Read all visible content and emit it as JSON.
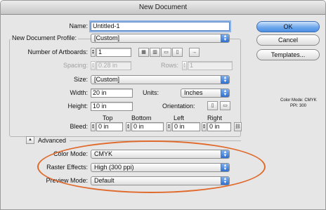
{
  "window": {
    "title": "New Document"
  },
  "name": {
    "label": "Name:",
    "value": "Untitled-1"
  },
  "profile": {
    "label": "New Document Profile:",
    "value": "[Custom]"
  },
  "artboards": {
    "label": "Number of Artboards:",
    "value": "1"
  },
  "spacing": {
    "label": "Spacing:",
    "value": "0.28 in"
  },
  "rows": {
    "label": "Rows:",
    "value": "1"
  },
  "size": {
    "label": "Size:",
    "value": "[Custom]"
  },
  "width": {
    "label": "Width:",
    "value": "20 in"
  },
  "units": {
    "label": "Units:",
    "value": "Inches"
  },
  "height": {
    "label": "Height:",
    "value": "10 in"
  },
  "orientation": {
    "label": "Orientation:"
  },
  "bleed": {
    "label": "Bleed:",
    "top": {
      "label": "Top",
      "value": "0 in"
    },
    "bottom": {
      "label": "Bottom",
      "value": "0 in"
    },
    "left": {
      "label": "Left",
      "value": "0 in"
    },
    "right": {
      "label": "Right",
      "value": "0 in"
    }
  },
  "advanced": {
    "label": "Advanced"
  },
  "color_mode": {
    "label": "Color Mode:",
    "value": "CMYK"
  },
  "raster_effects": {
    "label": "Raster Effects:",
    "value": "High (300 ppi)"
  },
  "preview_mode": {
    "label": "Preview Mode:",
    "value": "Default"
  },
  "buttons": {
    "ok": "OK",
    "cancel": "Cancel",
    "templates": "Templates..."
  },
  "info": {
    "line1": "Color Mode: CMYK",
    "line2": "PPI: 300"
  },
  "colors": {
    "highlight_ellipse": "#e06a2c",
    "default_button": "#4d8fe3"
  }
}
